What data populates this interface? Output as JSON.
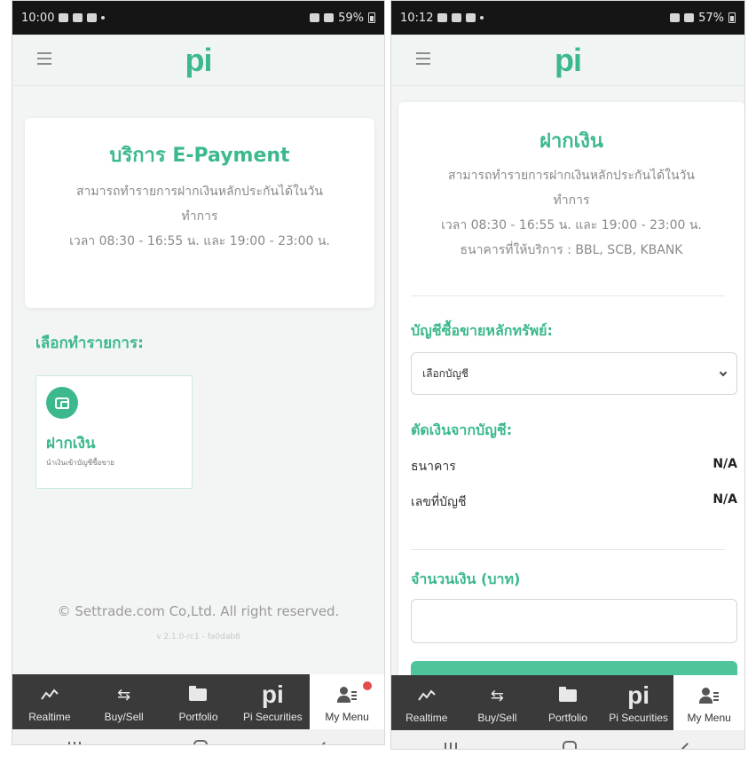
{
  "colors": {
    "brand": "#3cb98c",
    "tabbar": "#3a3a3a",
    "badge": "#e44b4b"
  },
  "left": {
    "status_time": "10:00",
    "status_battery": "59%",
    "logo": "pi",
    "title": "บริการ E-Payment",
    "desc_line1": "สามารถทำรายการฝากเงินหลักประกันได้ในวัน",
    "desc_line2": "ทำการ",
    "desc_line3": "เวลา 08:30 - 16:55 น. และ 19:00 - 23:00 น.",
    "section_label": "เลือกทำรายการ:",
    "tile_title": "ฝากเงิน",
    "tile_subtitle": "นำเงินเข้าบัญชีซื้อขาย",
    "copyright": "© Settrade.com Co,Ltd. All right reserved.",
    "version": "v 2.1.0-rc1 - fa0dab8"
  },
  "right": {
    "status_time": "10:12",
    "status_battery": "57%",
    "logo": "pi",
    "title": "ฝากเงิน",
    "desc_line1": "สามารถทำรายการฝากเงินหลักประกันได้ในวัน",
    "desc_line2": "ทำการ",
    "desc_line3": "เวลา 08:30 - 16:55 น. และ 19:00 - 23:00 น.",
    "desc_line4": "ธนาคารที่ให้บริการ : BBL, SCB, KBANK",
    "account_label": "บัญชีซื้อขายหลักทรัพย์:",
    "account_select_value": "เลือกบัญชี",
    "debit_label": "ตัดเงินจากบัญชี:",
    "bank_label": "ธนาคาร",
    "bank_value": "N/A",
    "accno_label": "เลขที่บัญชี",
    "accno_value": "N/A",
    "amount_label": "จำนวนเงิน (บาท)",
    "amount_value": ""
  },
  "tabs": [
    {
      "label": "Realtime",
      "icon": "chart-line-icon"
    },
    {
      "label": "Buy/Sell",
      "icon": "swap-arrows-icon"
    },
    {
      "label": "Portfolio",
      "icon": "folder-icon"
    },
    {
      "label": "Pi Securities",
      "icon": "pi-logo-icon"
    },
    {
      "label": "My Menu",
      "icon": "user-menu-icon"
    }
  ],
  "tabs_pi_glyph": "pi",
  "buysell_glyph": "⇆"
}
